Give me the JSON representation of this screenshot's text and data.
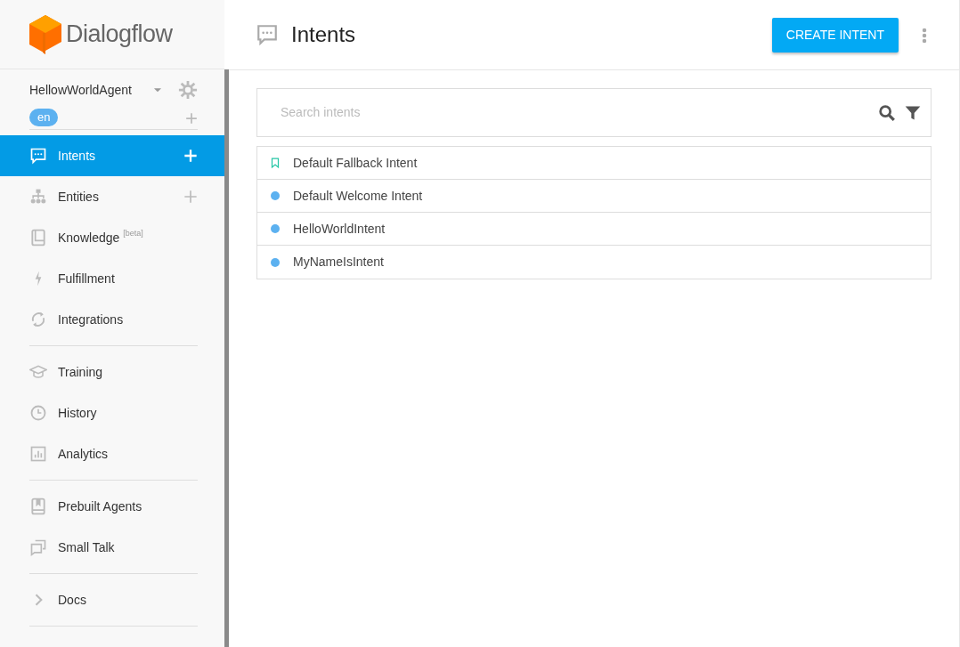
{
  "logo": {
    "text": "Dialogflow"
  },
  "agent": {
    "name": "HellowWorldAgent",
    "language": "en"
  },
  "sidebar": {
    "groups": [
      [
        {
          "label": "Intents",
          "selected": true,
          "add": true
        },
        {
          "label": "Entities",
          "selected": false,
          "add": true
        },
        {
          "label": "Knowledge $^{[beta]}$",
          "selected": false,
          "add": false
        },
        {
          "label": "Fulfillment",
          "selected": false,
          "add": false
        },
        {
          "label": "Integrations",
          "selected": false,
          "add": false
        }
      ],
      [
        {
          "label": "Training",
          "selected": false,
          "add": false
        },
        {
          "label": "History",
          "selected": false,
          "add": false
        },
        {
          "label": "Analytics",
          "selected": false,
          "add": false
        }
      ],
      [
        {
          "label": "Prebuilt Agents",
          "selected": false,
          "add": false
        },
        {
          "label": "Small Talk",
          "selected": false,
          "add": false
        }
      ],
      [
        {
          "label": "Docs",
          "selected": false,
          "add": false
        }
      ]
    ]
  },
  "page": {
    "title": "Intents",
    "primary_button": "CREATE INTENT"
  },
  "search": {
    "placeholder": "Search intents"
  },
  "intents": [
    {
      "name": "Default Fallback Intent",
      "kind": "fallback"
    },
    {
      "name": "Default Welcome Intent",
      "kind": "regular"
    },
    {
      "name": "HelloWorldIntent",
      "kind": "regular"
    },
    {
      "name": "MyNameIsIntent",
      "kind": "regular"
    }
  ]
}
